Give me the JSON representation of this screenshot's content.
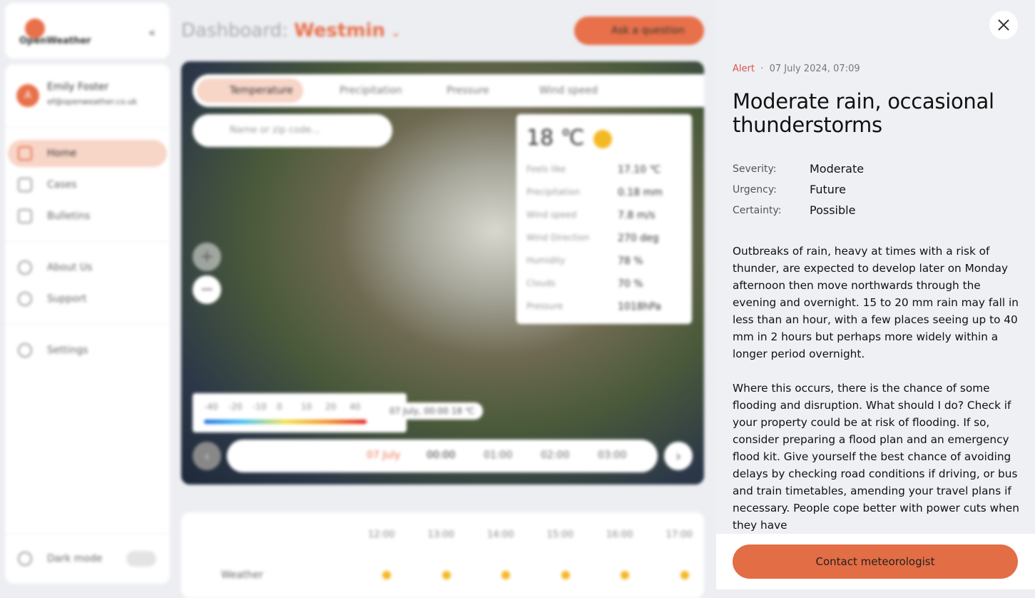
{
  "brand": {
    "name": "OpenWeather",
    "accent": "#e8704a"
  },
  "user": {
    "initial": "A",
    "name": "Emily Foster",
    "email": "ef@openweather.co.uk"
  },
  "sidebar": {
    "items": [
      {
        "label": "Home",
        "icon": "home-icon"
      },
      {
        "label": "Cases",
        "icon": "chat-icon"
      },
      {
        "label": "Bulletins",
        "icon": "document-icon"
      },
      {
        "label": "About Us",
        "icon": "info-icon"
      },
      {
        "label": "Support",
        "icon": "lifebuoy-icon"
      },
      {
        "label": "Settings",
        "icon": "gear-icon"
      }
    ],
    "dark_mode": "Dark mode"
  },
  "header": {
    "prefix": "Dashboard:",
    "location": "Westmin",
    "ask": "Ask a question"
  },
  "map": {
    "tabs": [
      "Temperature",
      "Precipitation",
      "Pressure",
      "Wind speed"
    ],
    "search_placeholder": "Name or zip code...",
    "info": {
      "temp": "18 ℃",
      "rows": [
        [
          "Feels like",
          "17.10 ℃"
        ],
        [
          "Precipitation",
          "0.18 mm"
        ],
        [
          "Wind speed",
          "7.8 m/s"
        ],
        [
          "Wind Direction",
          "270 deg"
        ],
        [
          "Humidity",
          "78 %"
        ],
        [
          "Clouds",
          "70 %"
        ],
        [
          "Pressure",
          "1018hPa"
        ]
      ]
    },
    "legend": [
      "-40",
      "-20",
      "-10",
      "0",
      "10",
      "20",
      "40"
    ],
    "chip": "07 July, 00:00  18 ℃",
    "timeline": [
      "07 July",
      "00:00",
      "01:00",
      "02:00",
      "03:00"
    ]
  },
  "forecast": {
    "hours": [
      "12:00",
      "13:00",
      "14:00",
      "15:00",
      "16:00",
      "17:00"
    ],
    "row_label": "Weather"
  },
  "alert": {
    "type": "Alert",
    "date": "07 July 2024, 07:09",
    "title": "Moderate rain, occasional thunderstorms",
    "fields": [
      {
        "k": "Severity:",
        "v": "Moderate"
      },
      {
        "k": "Urgency:",
        "v": "Future"
      },
      {
        "k": "Certainty:",
        "v": "Possible"
      }
    ],
    "body": [
      "Outbreaks of rain, heavy at times with a risk of thunder, are expected to develop later on Monday afternoon then move northwards through the evening and overnight. 15 to 20 mm rain may fall in less than an hour, with a few places seeing up to 40 mm in 2 hours but perhaps more widely within a longer period overnight.",
      "Where this occurs, there is the chance of some flooding and disruption. What should I do? Check if your property could be at risk of flooding. If so, consider preparing a flood plan and an emergency flood kit. Give yourself the best chance of avoiding delays by checking road conditions if driving, or bus and train timetables, amending your travel plans if necessary. People cope better with power cuts when they have"
    ],
    "cta": "Contact meteorologist"
  }
}
